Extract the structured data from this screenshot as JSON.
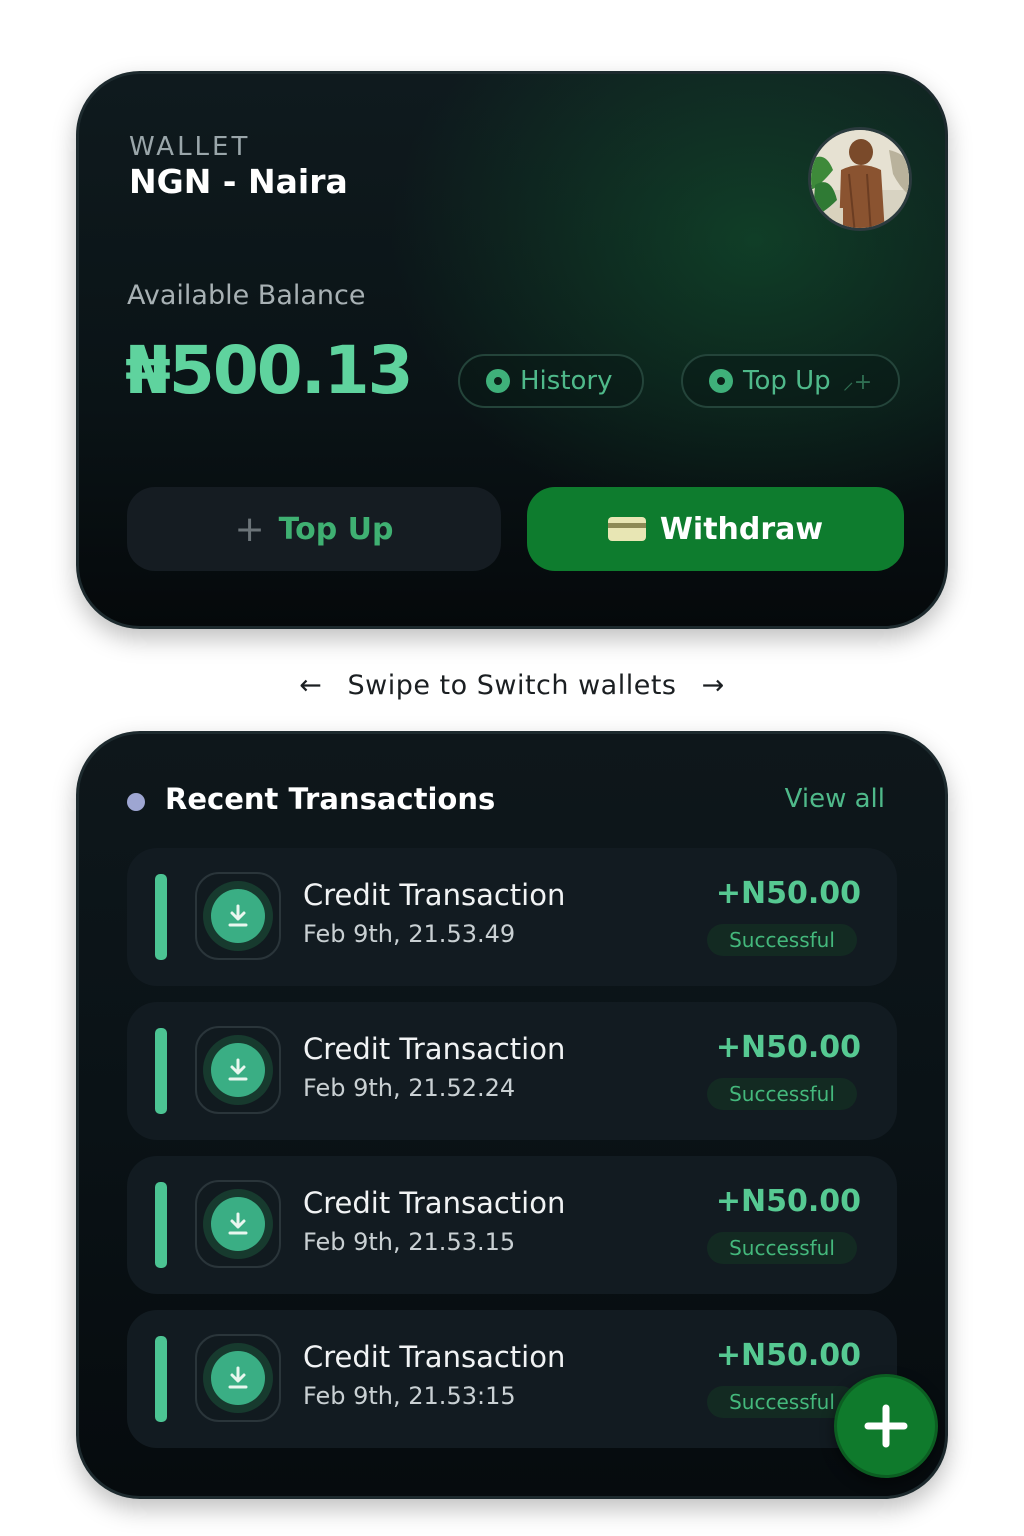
{
  "wallet": {
    "label": "WALLET",
    "currency": "NGN - Naira",
    "balance_label": "Available Balance",
    "balance": "₦500.13",
    "history_label": "History",
    "topup_pill_label": "Top Up",
    "topup_pill_extra": "⸝+",
    "topup_button_label": "Top Up",
    "withdraw_button_label": "Withdraw"
  },
  "swipe_hint": {
    "left_arrow": "←",
    "text": "Swipe to Switch wallets",
    "right_arrow": "→"
  },
  "transactions": {
    "title": "Recent Transactions",
    "view_all": "View all",
    "items": [
      {
        "name": "Credit Transaction",
        "date": "Feb 9th, 21.53.49",
        "amount": "+N50.00",
        "status": "Successful"
      },
      {
        "name": "Credit Transaction",
        "date": "Feb 9th, 21.52.24",
        "amount": "+N50.00",
        "status": "Successful"
      },
      {
        "name": "Credit Transaction",
        "date": "Feb 9th, 21.53.15",
        "amount": "+N50.00",
        "status": "Successful"
      },
      {
        "name": "Credit Transaction",
        "date": "Feb 9th, 21.53:15",
        "amount": "+N50.00",
        "status": "Successful"
      }
    ]
  },
  "icons": {
    "avatar": "user-avatar-photo",
    "pill": "dot-icon",
    "topup": "plus-icon",
    "withdraw": "credit-card-icon",
    "transaction": "download-icon",
    "fab": "plus-icon"
  },
  "colors": {
    "accent": "#5fd39e",
    "primary_button": "#0e7c2e",
    "card_background": "#0b1417",
    "status_text": "#44b87c"
  }
}
